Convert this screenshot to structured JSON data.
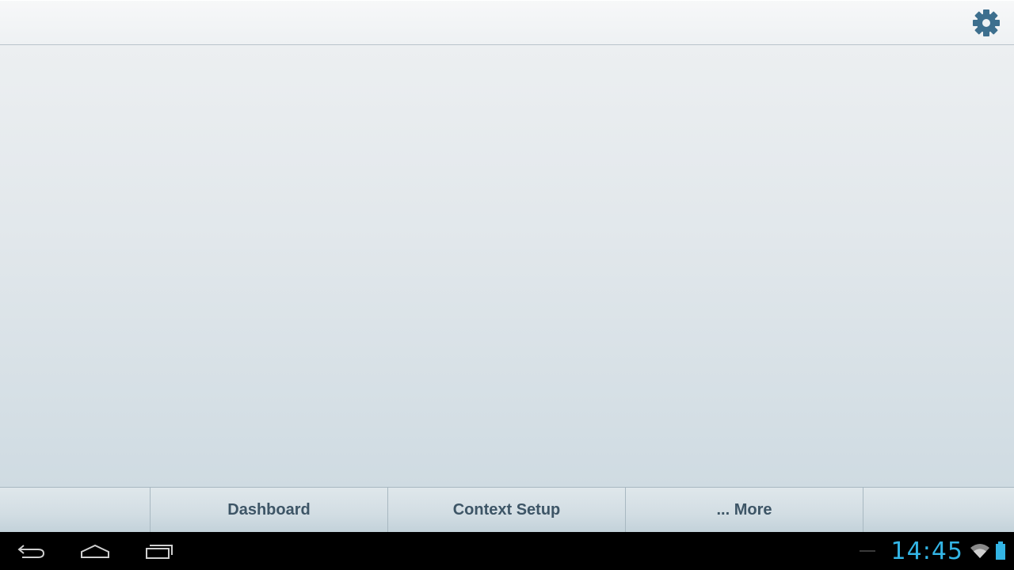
{
  "top_bar": {
    "settings_icon": "gear-icon",
    "colors": {
      "icon": "#3d6f8e"
    }
  },
  "tabs": [
    {
      "label": "Dashboard"
    },
    {
      "label": "Context Setup"
    },
    {
      "label": "... More"
    }
  ],
  "system_bar": {
    "back_icon": "back-icon",
    "home_icon": "home-icon",
    "recents_icon": "recents-icon",
    "clock": "14:45",
    "wifi_icon": "wifi-icon",
    "battery_icon": "battery-icon",
    "colors": {
      "accent": "#33b5e5",
      "nav_icon": "#cfcfcf"
    }
  }
}
